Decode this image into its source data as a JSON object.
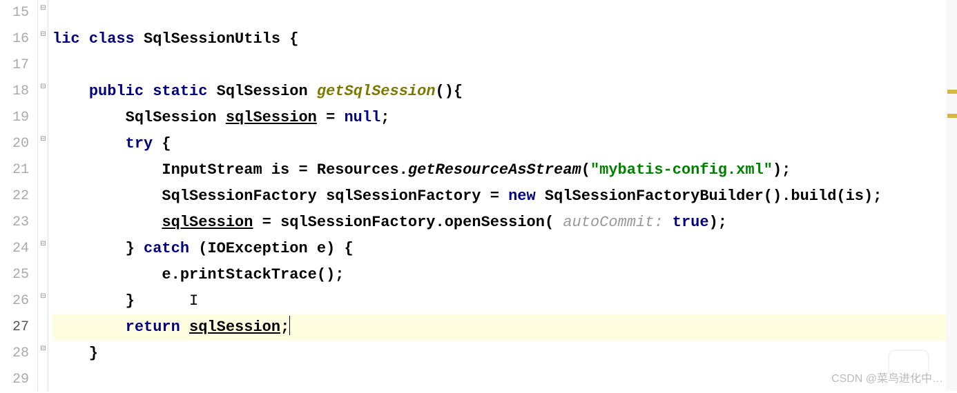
{
  "gutter": {
    "lines": [
      "15",
      "16",
      "17",
      "18",
      "19",
      "20",
      "21",
      "22",
      "23",
      "24",
      "25",
      "26",
      "27",
      "28",
      "29"
    ],
    "activeLine": "27"
  },
  "code": {
    "l15": "",
    "l16_kw1": "lic",
    "l16_kw2": "class",
    "l16_name": "SqlSessionUtils {",
    "l17": "",
    "l18_kw1": "public",
    "l18_kw2": "static",
    "l18_type": "SqlSession",
    "l18_method": "getSqlSession",
    "l18_tail": "(){",
    "l19_pre": "        SqlSession ",
    "l19_var": "sqlSession",
    "l19_post": " = ",
    "l19_null": "null",
    "l19_semi": ";",
    "l20_try": "try",
    "l20_brace": " {",
    "l21_pre": "            InputStream is = Resources.",
    "l21_call": "getResourceAsStream",
    "l21_paren": "(",
    "l21_str": "\"mybatis-config.xml\"",
    "l21_end": ");",
    "l22_pre": "            SqlSessionFactory sqlSessionFactory = ",
    "l22_new": "new",
    "l22_post": " SqlSessionFactoryBuilder().build(is);",
    "l23_pre": "            ",
    "l23_var": "sqlSession",
    "l23_mid": " = sqlSessionFactory.openSession( ",
    "l23_hint": "autoCommit:",
    "l23_sp": " ",
    "l23_true": "true",
    "l23_end": ");",
    "l24_pre": "        } ",
    "l24_catch": "catch",
    "l24_post": " (IOException e) {",
    "l25": "            e.printStackTrace();",
    "l26_pre": "        }      ",
    "l26_cursor": "I",
    "l27_pre": "        ",
    "l27_ret": "return",
    "l27_sp": " ",
    "l27_var": "sqlSession",
    "l27_semi": ";",
    "l28": "    }",
    "l29": ""
  },
  "watermark": "CSDN @菜鸟进化中…"
}
